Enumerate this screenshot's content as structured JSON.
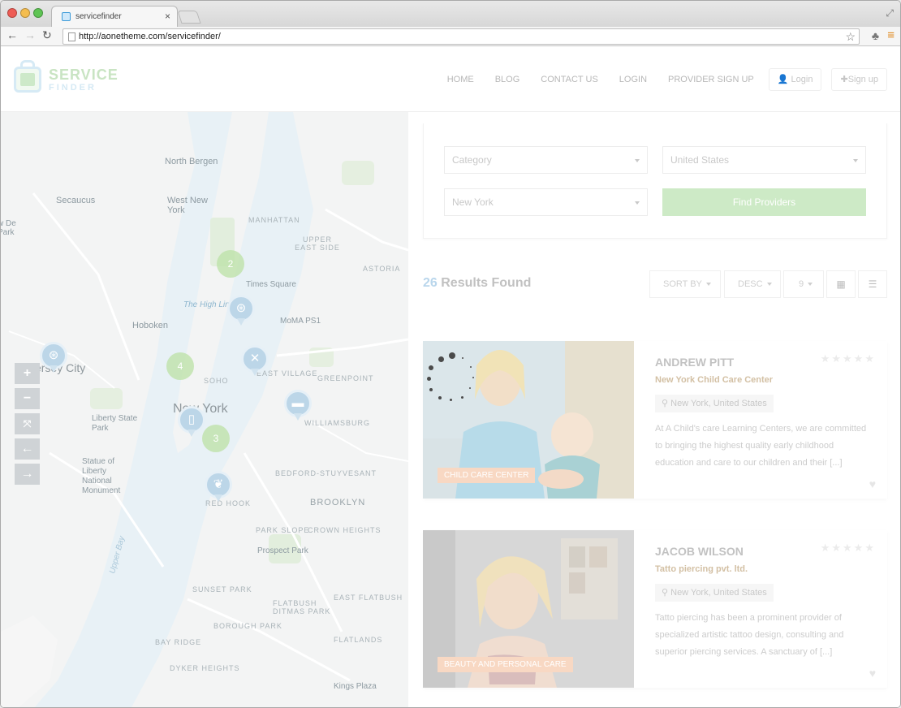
{
  "browser": {
    "tab_title": "servicefinder",
    "url": "http://aonetheme.com/servicefinder/"
  },
  "site": {
    "logo_line1": "SERVICE",
    "logo_line2": "FINDER",
    "nav": [
      "HOME",
      "BLOG",
      "CONTACT US",
      "LOGIN",
      "PROVIDER SIGN UP"
    ],
    "login_btn": "Login",
    "signup_btn": "Sign up"
  },
  "search": {
    "category_placeholder": "Category",
    "country": "United States",
    "city": "New York",
    "find_button": "Find Providers"
  },
  "results": {
    "count": "26",
    "label": "Results Found",
    "sort_by": "SORT BY",
    "order": "DESC",
    "per_page": "9"
  },
  "map": {
    "labels": {
      "north_bergen": "North Bergen",
      "secaucus": "Secaucus",
      "west_new_york": "West New York",
      "manhattan": "MANHATTAN",
      "upper_east_side": "UPPER EAST SIDE",
      "astoria": "ASTORIA",
      "times_square": "Times Square",
      "hoboken": "Hoboken",
      "the_high_line": "The High Line",
      "moma": "MoMA PS1",
      "jersey_city": "Jersey City",
      "east_village": "EAST VILLAGE",
      "greenpoint": "GREENPOINT",
      "soho": "SOHO",
      "new_york": "New York",
      "williamsburg": "WILLIAMSBURG",
      "liberty_state_park": "Liberty State Park",
      "statue_of_liberty": "Statue of Liberty National Monument",
      "bedford_stuyvesant": "BEDFORD-STUYVESANT",
      "red_hook": "RED HOOK",
      "brooklyn": "BROOKLYN",
      "park_slope": "PARK SLOPE",
      "crown_heights": "CROWN HEIGHTS",
      "prospect_park": "Prospect Park",
      "sunset_park": "SUNSET PARK",
      "east_flatbush": "EAST FLATBUSH",
      "flatbush_ditmas_park": "FLATBUSH DITMAS PARK",
      "borough_park": "BOROUGH PARK",
      "flatlands": "FLATLANDS",
      "bay_ridge": "BAY RIDGE",
      "dyker_heights": "DYKER HEIGHTS",
      "upper_bay": "Upper Bay",
      "kings_plaza": "Kings Plaza",
      "de_park": "w De Park"
    },
    "clusters": [
      "2",
      "4",
      "3"
    ],
    "pin_icons": [
      "steering-wheel-icon",
      "steering-wheel-icon",
      "utensils-icon",
      "bed-icon",
      "tablet-icon",
      "spa-icon"
    ]
  },
  "listings": [
    {
      "name": "ANDREW PITT",
      "company": "New York Child Care Center",
      "location": "New York, United States",
      "description": "At A Child's care Learning Centers, we are committed to bringing the highest quality early childhood education and care to our children and their [...]",
      "category": "CHILD CARE CENTER"
    },
    {
      "name": "JACOB WILSON",
      "company": "Tatto piercing pvt. ltd.",
      "location": "New York, United States",
      "description": "Tatto piercing has been a prominent provider of specialized artistic tattoo design, consulting and superior piercing services. A sanctuary of [...]",
      "category": "BEAUTY AND PERSONAL CARE"
    }
  ],
  "colors": {
    "accent_green": "#cdeac6",
    "badge": "#f8d8c3",
    "map_water": "#e8f1f6",
    "map_land": "#f3f4f4"
  }
}
